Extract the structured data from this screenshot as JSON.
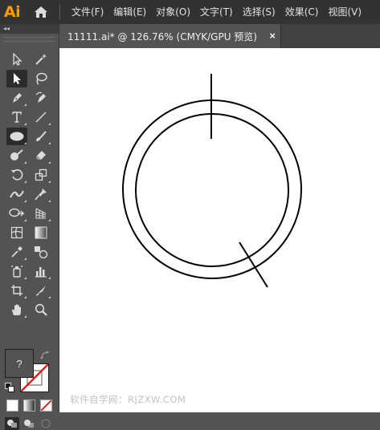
{
  "app": {
    "logo": "Ai"
  },
  "menu": {
    "items": [
      "文件(F)",
      "编辑(E)",
      "对象(O)",
      "文字(T)",
      "选择(S)",
      "效果(C)",
      "视图(V)"
    ]
  },
  "toolbar": {
    "collapse_label": "◂◂",
    "fill_label": "?"
  },
  "document": {
    "tab_label": "11111.ai* @ 126.76% (CMYK/GPU 预览)",
    "close_label": "×",
    "zoom_percent": 126.76
  },
  "watermark": "软件自学网：RJZXW.COM",
  "colors": {
    "accent": "#ff9a00",
    "ui_dark": "#323232",
    "panel": "#535353",
    "canvas": "#ffffff",
    "none_stroke": "#e0201a"
  },
  "icons": [
    "home-icon",
    "selection-tool-icon",
    "magic-wand-icon",
    "direct-selection-icon",
    "lasso-icon",
    "pen-tool-icon",
    "curvature-tool-icon",
    "type-tool-icon",
    "line-tool-icon",
    "ellipse-tool-icon",
    "paintbrush-icon",
    "blob-brush-icon",
    "eraser-icon",
    "rotate-tool-icon",
    "scale-tool-icon",
    "width-tool-icon",
    "puppet-warp-icon",
    "shape-builder-icon",
    "perspective-grid-icon",
    "mesh-tool-icon",
    "gradient-tool-icon",
    "eyedropper-icon",
    "blend-tool-icon",
    "symbol-sprayer-icon",
    "column-graph-icon",
    "artboard-tool-icon",
    "slice-tool-icon",
    "hand-tool-icon",
    "zoom-tool-icon"
  ]
}
